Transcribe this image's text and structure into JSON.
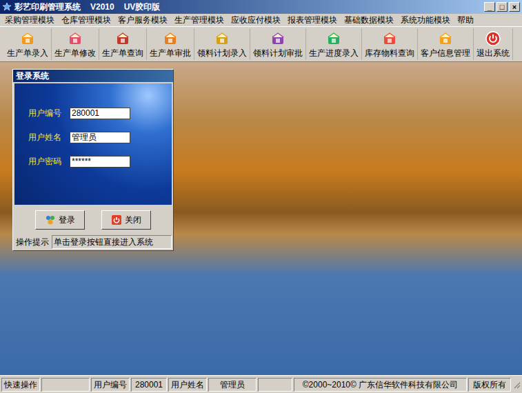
{
  "window": {
    "title": "彩艺印刷管理系统",
    "version": "V2010",
    "edition": "UV胶印版",
    "controls": [
      "_",
      "□",
      "×"
    ]
  },
  "menu": [
    "采购管理模块",
    "仓库管理模块",
    "客户服务模块",
    "生产管理模块",
    "应收应付模块",
    "报表管理模块",
    "基础数据模块",
    "系统功能模块",
    "帮助"
  ],
  "toolbar": [
    {
      "label": "生产单录入"
    },
    {
      "label": "生产单修改"
    },
    {
      "label": "生产单查询"
    },
    {
      "label": "生产单审批"
    },
    {
      "label": "领料计划录入"
    },
    {
      "label": "领料计划审批"
    },
    {
      "label": "生产进度录入"
    },
    {
      "label": "库存物料查询"
    },
    {
      "label": "客户信息管理"
    },
    {
      "label": "退出系统"
    }
  ],
  "login_dialog": {
    "title": "登录系统",
    "fields": [
      {
        "label": "用户编号",
        "value": "280001"
      },
      {
        "label": "用户姓名",
        "value": "管理员"
      },
      {
        "label": "用户密码",
        "value": "******"
      }
    ],
    "buttons": [
      "登录",
      "关闭"
    ],
    "hint_label": "操作提示",
    "hint": "单击登录按钮直接进入系统"
  },
  "status_bar": [
    {
      "text": "快速操作"
    },
    {
      "text": ""
    },
    {
      "text": "用户编号"
    },
    {
      "text": "280001"
    },
    {
      "text": "用户姓名"
    },
    {
      "text": "管理员"
    },
    {
      "text": ""
    },
    {
      "text": "©2000~2010©  广东信华软件科技有限公司"
    },
    {
      "text": "版权所有"
    }
  ]
}
